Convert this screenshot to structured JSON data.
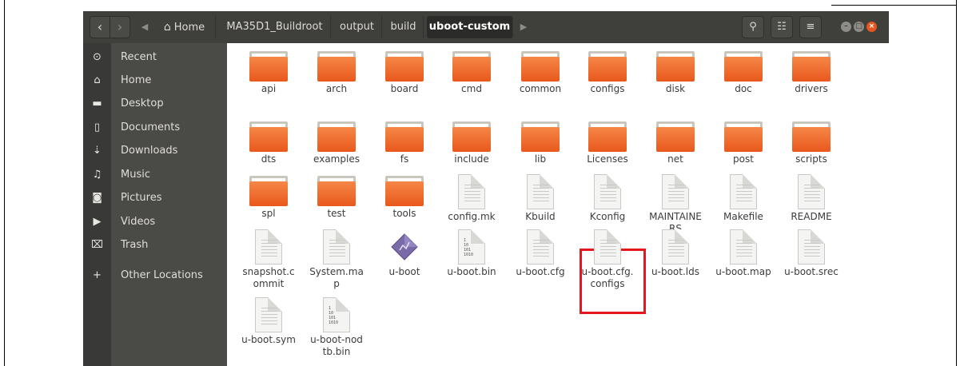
{
  "header": {
    "back_glyph": "‹",
    "forward_glyph": "›",
    "breadcrumbs": [
      {
        "label": "Home",
        "icon": "home-icon"
      },
      {
        "label": "MA35D1_Buildroot"
      },
      {
        "label": "output"
      },
      {
        "label": "build"
      },
      {
        "label": "uboot-custom"
      }
    ],
    "search_glyph": "🔍",
    "view_glyph": "☷",
    "menu_glyph": "≡",
    "window_controls": {
      "minimize": "–",
      "maximize": "□",
      "close": "×"
    },
    "colors": {
      "close": "#e95420",
      "other": "#8e8c86"
    }
  },
  "sidebar": {
    "items": [
      {
        "label": "Recent",
        "icon": "recent-icon",
        "glyph": "⊙"
      },
      {
        "label": "Home",
        "icon": "home-icon",
        "glyph": "⌂"
      },
      {
        "label": "Desktop",
        "icon": "desktop-icon",
        "glyph": "▬"
      },
      {
        "label": "Documents",
        "icon": "documents-icon",
        "glyph": "▯"
      },
      {
        "label": "Downloads",
        "icon": "downloads-icon",
        "glyph": "⇣"
      },
      {
        "label": "Music",
        "icon": "music-icon",
        "glyph": "♫"
      },
      {
        "label": "Pictures",
        "icon": "pictures-icon",
        "glyph": "◙"
      },
      {
        "label": "Videos",
        "icon": "videos-icon",
        "glyph": "▶"
      },
      {
        "label": "Trash",
        "icon": "trash-icon",
        "glyph": "⌧"
      },
      {
        "label": "Other Locations",
        "icon": "plus-icon",
        "glyph": "+"
      }
    ]
  },
  "files": [
    {
      "name": "api",
      "type": "folder"
    },
    {
      "name": "arch",
      "type": "folder"
    },
    {
      "name": "board",
      "type": "folder"
    },
    {
      "name": "cmd",
      "type": "folder"
    },
    {
      "name": "common",
      "type": "folder"
    },
    {
      "name": "configs",
      "type": "folder"
    },
    {
      "name": "disk",
      "type": "folder"
    },
    {
      "name": "doc",
      "type": "folder"
    },
    {
      "name": "drivers",
      "type": "folder"
    },
    {
      "name": "dts",
      "type": "folder"
    },
    {
      "name": "examples",
      "type": "folder"
    },
    {
      "name": "fs",
      "type": "folder"
    },
    {
      "name": "include",
      "type": "folder"
    },
    {
      "name": "lib",
      "type": "folder"
    },
    {
      "name": "Licenses",
      "type": "folder"
    },
    {
      "name": "net",
      "type": "folder"
    },
    {
      "name": "post",
      "type": "folder"
    },
    {
      "name": "scripts",
      "type": "folder"
    },
    {
      "name": "spl",
      "type": "folder"
    },
    {
      "name": "test",
      "type": "folder"
    },
    {
      "name": "tools",
      "type": "folder"
    },
    {
      "name": "config.mk",
      "type": "text"
    },
    {
      "name": "Kbuild",
      "type": "text"
    },
    {
      "name": "Kconfig",
      "type": "text"
    },
    {
      "name": "MAINTAINERS",
      "type": "text"
    },
    {
      "name": "Makefile",
      "type": "text"
    },
    {
      "name": "README",
      "type": "text"
    },
    {
      "name": "snapshot.commit",
      "type": "text"
    },
    {
      "name": "System.map",
      "type": "text"
    },
    {
      "name": "u-boot",
      "type": "executable"
    },
    {
      "name": "u-boot.bin",
      "type": "binary",
      "highlighted": true
    },
    {
      "name": "u-boot.cfg",
      "type": "text"
    },
    {
      "name": "u-boot.cfg.configs",
      "type": "text"
    },
    {
      "name": "u-boot.lds",
      "type": "text"
    },
    {
      "name": "u-boot.map",
      "type": "text"
    },
    {
      "name": "u-boot.srec",
      "type": "text"
    },
    {
      "name": "u-boot.sym",
      "type": "text"
    },
    {
      "name": "u-boot-nodtb.bin",
      "type": "binary"
    }
  ],
  "binary_preview": "1\n10\n101\n1010",
  "highlight_color": "#e5171c"
}
